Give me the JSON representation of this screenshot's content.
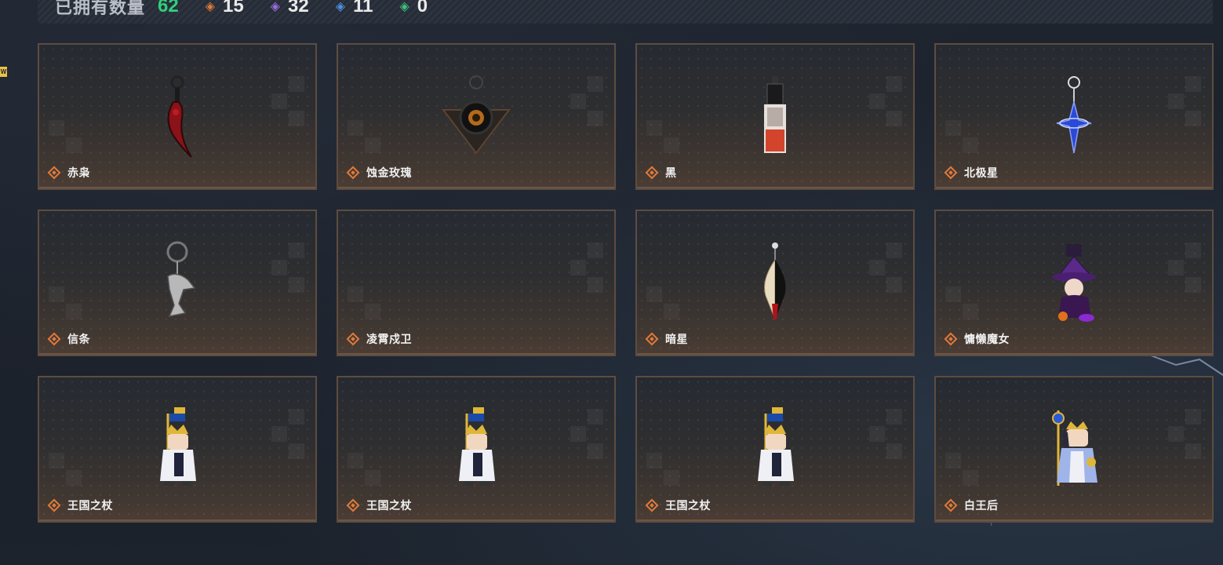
{
  "stats": {
    "label": "已拥有数量",
    "total": "62",
    "counts": [
      {
        "gem": "orange-diamond-icon",
        "color": "#e07a3a",
        "value": "15"
      },
      {
        "gem": "purple-diamond-icon",
        "color": "#9b6ae0",
        "value": "32"
      },
      {
        "gem": "blue-diamond-icon",
        "color": "#4f8fe0",
        "value": "11"
      },
      {
        "gem": "green-diamond-icon",
        "color": "#3fc07a",
        "value": "0"
      }
    ]
  },
  "side_tag": "W",
  "colors": {
    "rarity": "#e07a3a",
    "total": "#2fd07a",
    "card_border": "#5d4c40"
  },
  "items": [
    {
      "name": "赤枭",
      "art": "red-claw-keychain"
    },
    {
      "name": "蚀金玫瑰",
      "art": "black-gold-rose-keychain"
    },
    {
      "name": "黑",
      "art": "card-tag-keychain"
    },
    {
      "name": "北极星",
      "art": "blue-star-keychain"
    },
    {
      "name": "信条",
      "art": "silver-eagle-keychain"
    },
    {
      "name": "凌霄戍卫",
      "art": "empty"
    },
    {
      "name": "暗星",
      "art": "half-mask-keychain"
    },
    {
      "name": "慵懒魔女",
      "art": "witch-figure-keychain"
    },
    {
      "name": "王国之杖",
      "art": "king-figure-keychain"
    },
    {
      "name": "王国之杖",
      "art": "king-figure-keychain"
    },
    {
      "name": "王国之杖",
      "art": "king-figure-keychain"
    },
    {
      "name": "白王后",
      "art": "queen-figure-keychain"
    }
  ]
}
